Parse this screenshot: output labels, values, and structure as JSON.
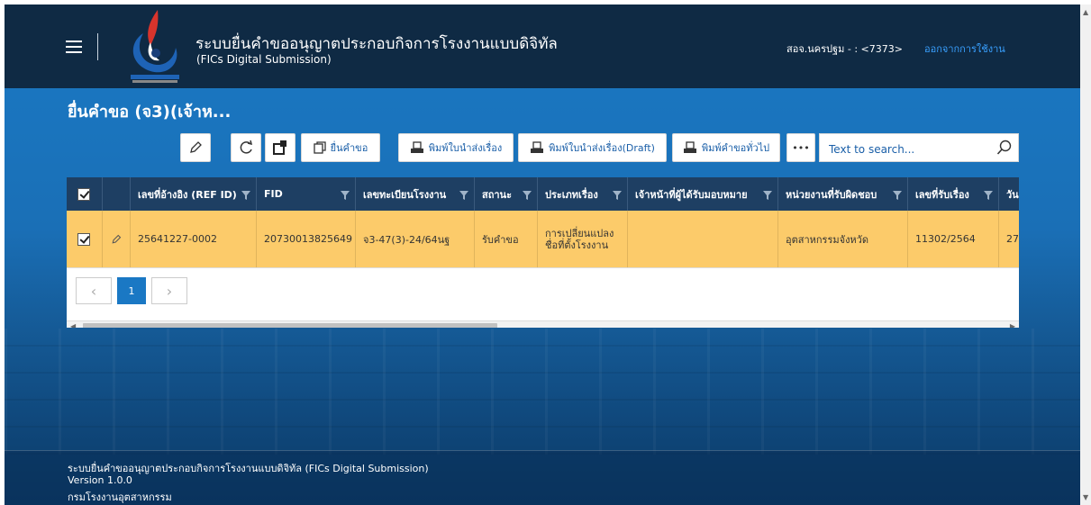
{
  "header": {
    "title_main": "ระบบยื่นคำขออนุญาตประกอบกิจการโรงงานแบบดิจิทัล",
    "title_sub": "(FICs Digital Submission)",
    "user_info": "สอจ.นครปฐม - : <7373>",
    "logout": "ออกจากการใช้งาน"
  },
  "page": {
    "title": "ยื่นคำขอ (จ3)(เจ้าห..."
  },
  "toolbar": {
    "submit": "ยื่นคำขอ",
    "print_memo": "พิมพ์ใบนำส่งเรื่อง",
    "print_memo_draft": "พิมพ์ใบนำส่งเรื่อง(Draft)",
    "print_general": "พิมพ์คำขอทั่วไป",
    "more": "•••",
    "search_placeholder": "Text to search..."
  },
  "grid": {
    "columns": [
      "เลขที่อ้างอิง (REF ID)",
      "FID",
      "เลขทะเบียนโรงงาน",
      "สถานะ",
      "ประเภทเรื่อง",
      "เจ้าหน้าที่ผู้ได้รับมอบหมาย",
      "หน่วยงานที่รับผิดชอบ",
      "เลขที่รับเรื่อง",
      "วัน"
    ],
    "rows": [
      {
        "ref_id": "25641227-0002",
        "fid": "20730013825649",
        "factory_reg": "จ3-47(3)-24/64นฐ",
        "status": "รับคำขอ",
        "type": "การเปลี่ยนแปลงชื่อที่ตั้งโรงงาน",
        "officer": "",
        "department": "อุตสาหกรรมจังหวัด",
        "receive_no": "11302/2564",
        "date": "27"
      }
    ]
  },
  "pager": {
    "current_page": "1"
  },
  "footer": {
    "line1": "ระบบยื่นคำขออนุญาตประกอบกิจการโรงงานแบบดิจิทัล (FICs Digital Submission)",
    "line2": "Version 1.0.0",
    "line3": "กรมโรงงานอุตสาหกรรม"
  },
  "colors": {
    "header_bg": "#0f2a44",
    "grid_header_bg": "#1e3f63",
    "selected_row_bg": "#fccb6a",
    "accent": "#1a78c4",
    "link": "#39a0ff"
  }
}
